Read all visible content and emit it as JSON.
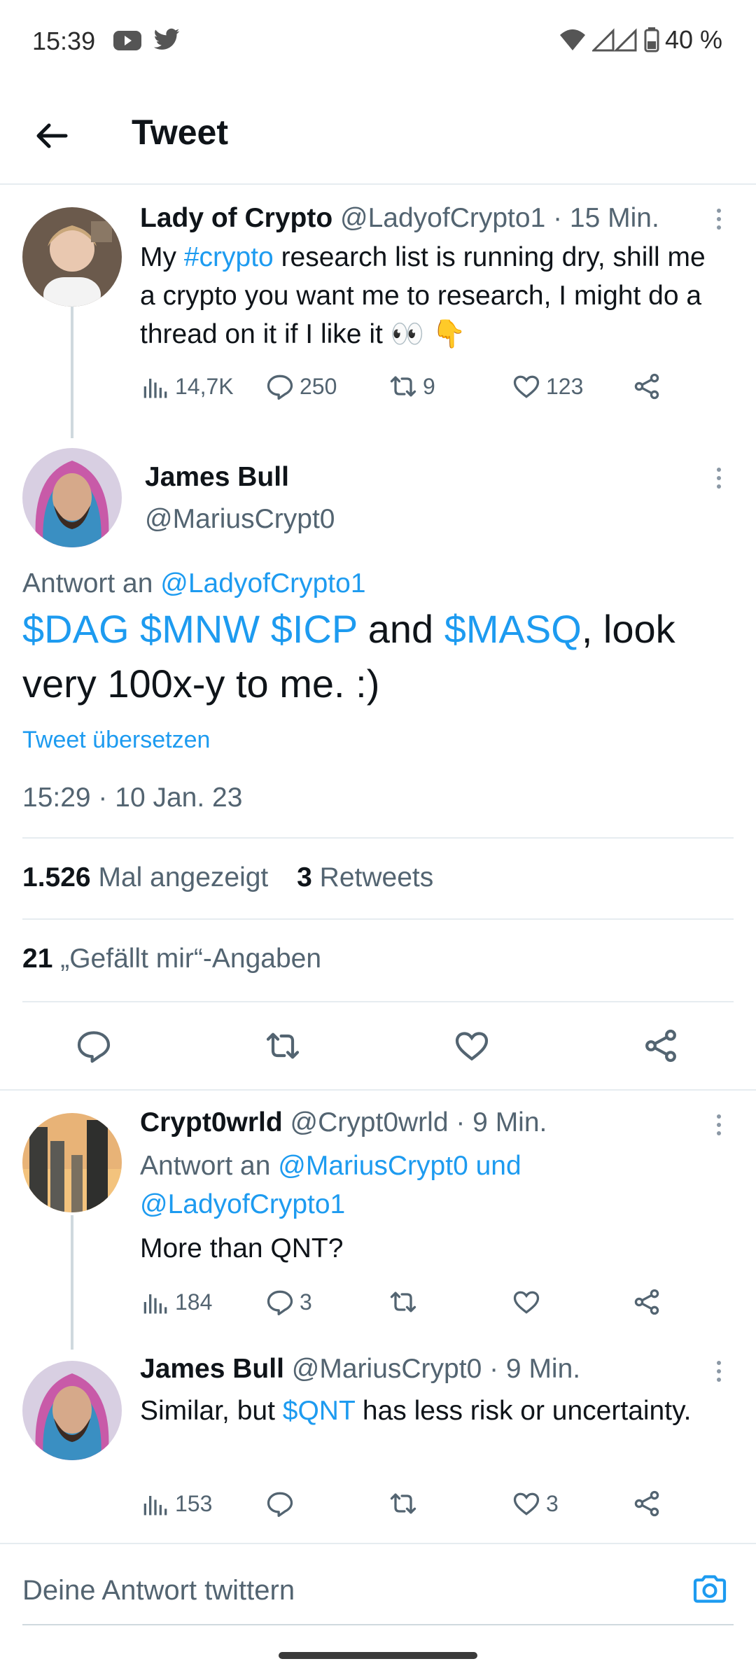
{
  "status_bar": {
    "time": "15:39",
    "battery": "40 %",
    "icons": [
      "youtube-icon",
      "twitter-icon",
      "wifi-icon",
      "signal-icon",
      "battery-icon"
    ]
  },
  "header": {
    "title": "Tweet"
  },
  "parent_tweet": {
    "name": "Lady of Crypto",
    "handle_time": "@LadyofCrypto1 · 15 Min.",
    "text_pre": "My ",
    "hashtag": "#crypto",
    "text_post": " research list is running dry, shill me a crypto you want me to research, I might do a thread on it if I like it 👀 👇",
    "views": "14,7K",
    "replies": "250",
    "retweets": "9",
    "likes": "123"
  },
  "main_tweet": {
    "name": "James Bull",
    "handle": "@MariusCrypt0",
    "reply_to_prefix": "Antwort an ",
    "reply_to_handle": "@LadyofCrypto1",
    "cashtags": "$DAG $MNW $ICP",
    "text_and": " and ",
    "cashtag_last": "$MASQ",
    "text_rest": ", look very 100x-y to me. :)",
    "translate": "Tweet übersetzen",
    "timestamp": "15:29 · 10 Jan. 23",
    "views_count": "1.526",
    "views_label": "Mal angezeigt",
    "retweets_count": "3",
    "retweets_label": "Retweets",
    "likes_count": "21",
    "likes_label": "„Gefällt mir“-Angaben"
  },
  "replies": [
    {
      "name": "Crypt0wrld",
      "handle_time": "@Crypt0wrld · 9 Min.",
      "reply_prefix": "Antwort an ",
      "reply_handles": "@MariusCrypt0 und @LadyofCrypto1",
      "text": "More than QNT?",
      "views": "184",
      "replies": "3",
      "retweets": "",
      "likes": ""
    },
    {
      "name": "James Bull",
      "handle_time": "@MariusCrypt0 · 9 Min.",
      "text_pre": "Similar, but ",
      "cashtag": "$QNT",
      "text_post": " has less risk or uncertainty.",
      "views": "153",
      "replies": "",
      "retweets": "",
      "likes": "3"
    }
  ],
  "compose": {
    "placeholder": "Deine Antwort twittern"
  },
  "colors": {
    "link": "#1d9bf0",
    "text": "#0f1419",
    "secondary": "#536471"
  }
}
